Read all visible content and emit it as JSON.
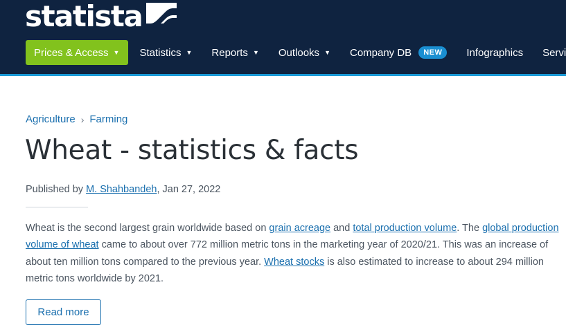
{
  "logo": {
    "text": "statista"
  },
  "nav": {
    "items": [
      {
        "label": "Prices & Access",
        "caret": "▼"
      },
      {
        "label": "Statistics",
        "caret": "▼"
      },
      {
        "label": "Reports",
        "caret": "▼"
      },
      {
        "label": "Outlooks",
        "caret": "▼"
      },
      {
        "label": "Company DB",
        "badge": "NEW"
      },
      {
        "label": "Infographics"
      },
      {
        "label": "Services"
      }
    ]
  },
  "breadcrumb": {
    "items": [
      "Agriculture",
      "Farming"
    ],
    "separator": "›"
  },
  "title": "Wheat - statistics & facts",
  "published": {
    "prefix": "Published by ",
    "author": "M. Shahbandeh",
    "suffix": ", Jan 27, 2022"
  },
  "body": {
    "t1": "Wheat is the second largest grain worldwide based on ",
    "link1": "grain acreage",
    "t2": " and ",
    "link2": "total production volume",
    "t3": ". The ",
    "link3": "global production volume of wheat",
    "t4": " came to about over 772 million metric tons in the marketing year of 2020/21. This was an increase of about ten million tons compared to the previous year. ",
    "link4": "Wheat stocks",
    "t5": " is also estimated to increase to about 294 million metric tons worldwide by 2021."
  },
  "read_more": "Read more",
  "colors": {
    "header": "#0f2340",
    "accent": "#1a9ad7",
    "primary_button": "#82c21d",
    "link": "#1a6fae",
    "badge": "#1a8fd2"
  }
}
